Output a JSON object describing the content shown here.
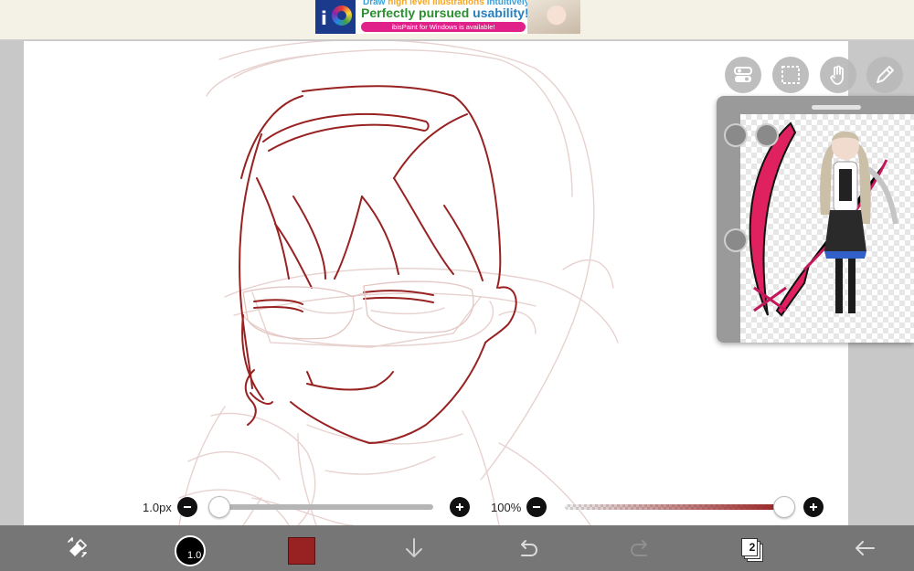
{
  "ad": {
    "top_line_a": "Draw ",
    "top_line_hl": "high level illustrations",
    "top_line_b": " intuitively!",
    "headline_a": "Perfectly pursued ",
    "headline_b": "usability!",
    "pill": "ibisPaint for Windows is available!"
  },
  "brush": {
    "size_label": "1.0px",
    "size_value": 0.0,
    "opacity_label": "100%",
    "opacity_value": 1.0,
    "color": "#982222",
    "toolbar_size": "1.0"
  },
  "layers": {
    "count": "2"
  },
  "icons": {
    "tool_select": "transform-eraser-icon",
    "undo": "undo-icon",
    "redo": "redo-icon",
    "back": "back-arrow-icon",
    "move_down": "move-down-arrow-icon",
    "reference_settings": "reference-settings-icon",
    "frame": "frame-icon",
    "hand": "hand-icon",
    "pen": "pen-icon"
  },
  "colors": {
    "sketch_line": "#982222",
    "rough_line": "#e7d2cf",
    "toolbar_bg": "#767676"
  }
}
